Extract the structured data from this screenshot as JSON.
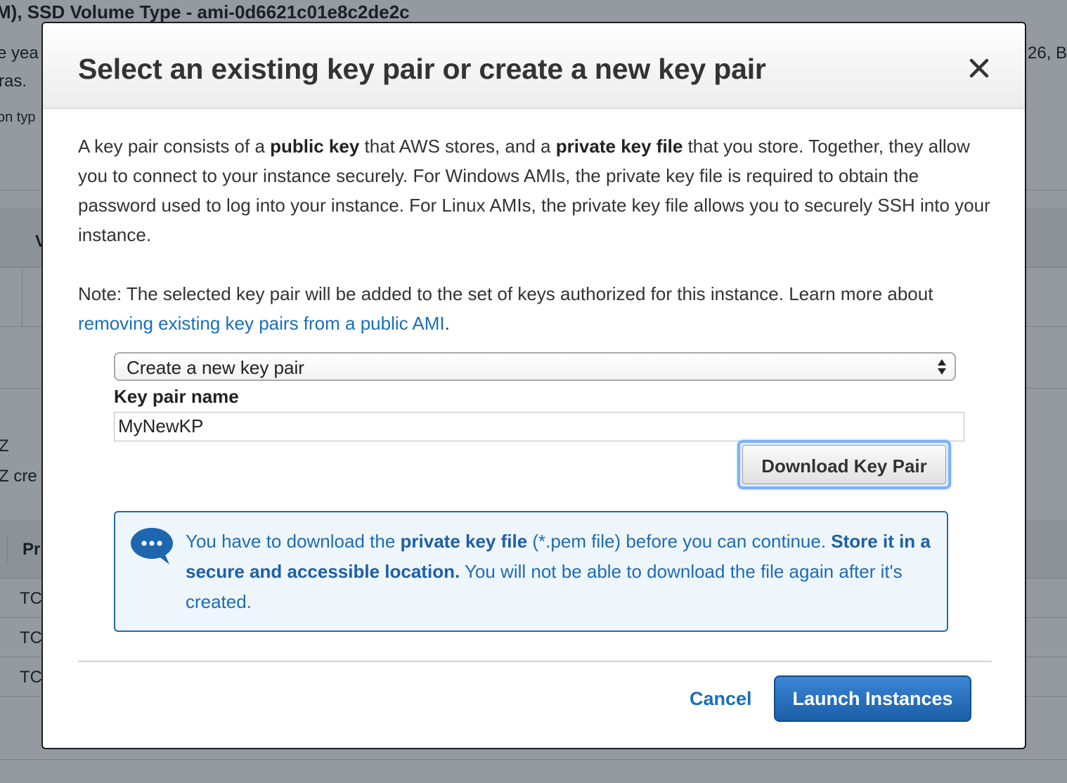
{
  "background": {
    "ami_heading": "M), SSD Volume Type - ami-0d6621c01e8c2de2c",
    "desc_line1_left": "e yea",
    "desc_line1_right": "26, B",
    "desc_line2": "ras.",
    "desc_line3": "on typ",
    "table_stub": "V",
    "az_line1": "Z",
    "az_line2": "Z cre",
    "col_header": "Pr",
    "rows": [
      "TC",
      "TC",
      "TC"
    ]
  },
  "modal": {
    "title": "Select an existing key pair or create a new key pair",
    "close_symbol": "✕",
    "intro": {
      "t1": "A key pair consists of a ",
      "b1": "public key",
      "t2": " that AWS stores, and a ",
      "b2": "private key file",
      "t3": " that you store. Together, they allow you to connect to your instance securely. For Windows AMIs, the private key file is required to obtain the password used to log into your instance. For Linux AMIs, the private key file allows you to securely SSH into your instance."
    },
    "note": {
      "t1": "Note: The selected key pair will be added to the set of keys authorized for this instance. Learn more about ",
      "link": "removing existing key pairs from a public AMI",
      "t2": "."
    },
    "key_pair_select": {
      "selected": "Create a new key pair"
    },
    "key_pair_name": {
      "label": "Key pair name",
      "value": "MyNewKP"
    },
    "download_button": "Download Key Pair",
    "info": {
      "t1": "You have to download the ",
      "b1": "private key file",
      "t2": " (*.pem file) before you can continue. ",
      "b2": "Store it in a secure and accessible location.",
      "t3": " You will not be able to download the file again after it's created."
    },
    "cancel_label": "Cancel",
    "launch_label": "Launch Instances"
  },
  "colors": {
    "accent": "#1a6fb7",
    "primary_button": "#1f66b0",
    "info_border": "#1f6bb5",
    "info_background": "#eef6fc"
  }
}
